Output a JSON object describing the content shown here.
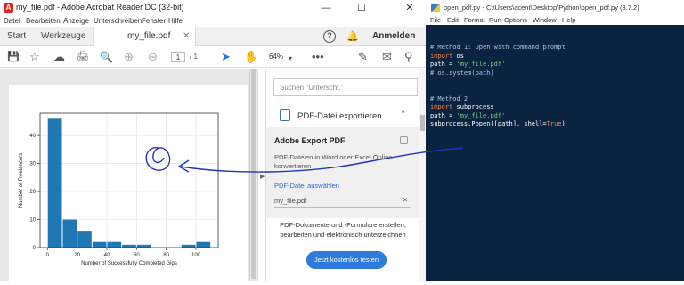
{
  "acrobat": {
    "window_title": "my_file.pdf - Adobe Acrobat Reader DC (32-bit)",
    "menu": [
      "Datei",
      "Bearbeiten",
      "Anzeige",
      "Unterschreiben",
      "Fenster",
      "Hilfe"
    ],
    "tabs": {
      "home": "Start",
      "tools": "Werkzeuge",
      "document": "my_file.pdf"
    },
    "login": "Anmelden",
    "toolbar": {
      "page_current": "1",
      "page_total": "/ 1",
      "zoom": "64%"
    },
    "side_panel": {
      "search_placeholder": "Suchen \"Unterschr.\"",
      "export_title": "PDF-Datei exportieren",
      "export_heading": "Adobe Export PDF",
      "export_desc": "PDF-Dateien in Word oder Excel Online konvertieren",
      "select_link": "PDF-Datei auswählen",
      "selected_file": "my_file.pdf",
      "promo_text": "PDF-Dokumente und -Formulare erstellen, bearbeiten und elektronisch unterzeichnen",
      "promo_button": "Jetzt kostenlos testen"
    }
  },
  "idle": {
    "window_title": "open_pdf.py - C:\\Users\\acent\\Desktop\\Python\\open_pdf.py (3.7.2)",
    "menu": [
      "File",
      "Edit",
      "Format",
      "Run",
      "Options",
      "Window",
      "Help"
    ],
    "code": [
      [
        {
          "t": "# Method 1: Open with command prompt",
          "c": "com"
        }
      ],
      [
        {
          "t": "import",
          "c": "kw"
        },
        {
          "t": " os",
          "c": "txt"
        }
      ],
      [
        {
          "t": "path = ",
          "c": "txt"
        },
        {
          "t": "'my_file.pdf'",
          "c": "str"
        }
      ],
      [
        {
          "t": "# os.system(path)",
          "c": "com"
        }
      ],
      [],
      [],
      [
        {
          "t": "# Method 2",
          "c": "com"
        }
      ],
      [
        {
          "t": "import",
          "c": "kw"
        },
        {
          "t": " subprocess",
          "c": "txt"
        }
      ],
      [
        {
          "t": "path = ",
          "c": "txt"
        },
        {
          "t": "'my_file.pdf'",
          "c": "str"
        }
      ],
      [
        {
          "t": "subprocess.Popen([path], shell=",
          "c": "txt"
        },
        {
          "t": "True",
          "c": "tr"
        },
        {
          "t": ")",
          "c": "txt"
        }
      ]
    ]
  },
  "chart_data": {
    "type": "bar",
    "x_edges": [
      0,
      10,
      20,
      30,
      40,
      50,
      60,
      70,
      80,
      90,
      100,
      110
    ],
    "values": [
      46,
      10,
      6,
      2,
      2,
      1,
      1,
      0,
      0,
      1,
      2
    ],
    "xlabel": "Number of Successfully Completed Gigs",
    "ylabel": "Number of Freelancers",
    "xticks": [
      0,
      20,
      40,
      60,
      80,
      100
    ],
    "yticks": [
      0,
      10,
      20,
      30,
      40
    ],
    "xlim": [
      -5,
      115
    ],
    "ylim": [
      0,
      48
    ],
    "grid": true,
    "bar_color": "#1f77b4"
  }
}
